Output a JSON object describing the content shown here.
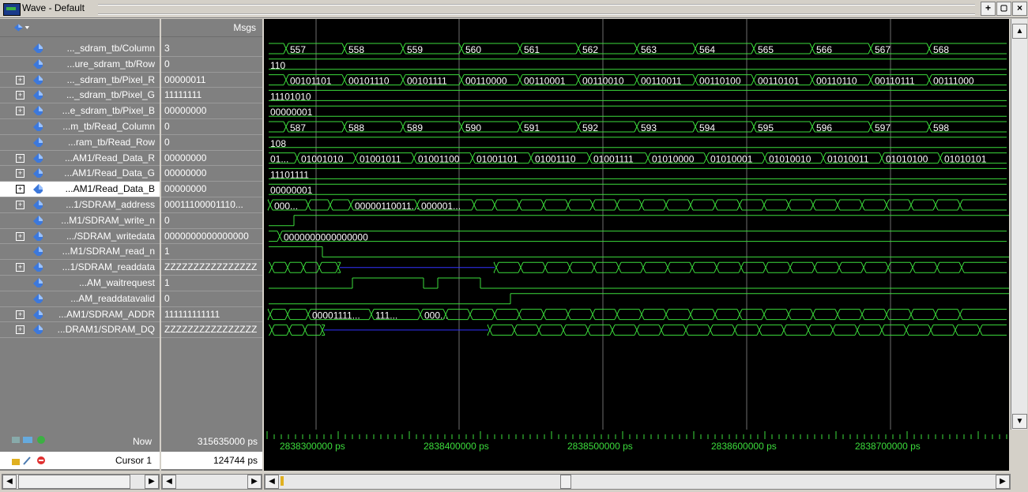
{
  "window": {
    "title": "Wave - Default"
  },
  "header": {
    "msgs_label": "Msgs"
  },
  "signals": [
    {
      "name": "..._sdram_tb/Column",
      "value": "3",
      "expandable": false
    },
    {
      "name": "...ure_sdram_tb/Row",
      "value": "0",
      "expandable": false
    },
    {
      "name": "..._sdram_tb/Pixel_R",
      "value": "00000011",
      "expandable": true
    },
    {
      "name": "..._sdram_tb/Pixel_G",
      "value": "11111111",
      "expandable": true
    },
    {
      "name": "...e_sdram_tb/Pixel_B",
      "value": "00000000",
      "expandable": true
    },
    {
      "name": "...m_tb/Read_Column",
      "value": "0",
      "expandable": false
    },
    {
      "name": "...ram_tb/Read_Row",
      "value": "0",
      "expandable": false
    },
    {
      "name": "...AM1/Read_Data_R",
      "value": "00000000",
      "expandable": true
    },
    {
      "name": "...AM1/Read_Data_G",
      "value": "00000000",
      "expandable": true
    },
    {
      "name": "...AM1/Read_Data_B",
      "value": "00000000",
      "expandable": true,
      "selected": true
    },
    {
      "name": "...1/SDRAM_address",
      "value": "00011100001110...",
      "expandable": true
    },
    {
      "name": "...M1/SDRAM_write_n",
      "value": "0",
      "expandable": false
    },
    {
      "name": ".../SDRAM_writedata",
      "value": "0000000000000000",
      "expandable": true
    },
    {
      "name": "...M1/SDRAM_read_n",
      "value": "1",
      "expandable": false
    },
    {
      "name": "...1/SDRAM_readdata",
      "value": "ZZZZZZZZZZZZZZZZ",
      "expandable": true
    },
    {
      "name": "...AM_waitrequest",
      "value": "1",
      "expandable": false
    },
    {
      "name": "...AM_readdatavalid",
      "value": "0",
      "expandable": false
    },
    {
      "name": "...AM1/SDRAM_ADDR",
      "value": "111111111111",
      "expandable": true
    },
    {
      "name": "...DRAM1/SDRAM_DQ",
      "value": "ZZZZZZZZZZZZZZZZ",
      "expandable": true
    }
  ],
  "wave_labels": {
    "column": [
      "557",
      "558",
      "559",
      "560",
      "561",
      "562",
      "563",
      "564",
      "565",
      "566",
      "567",
      "568"
    ],
    "row": "110",
    "pixel_r": [
      "00101101",
      "00101110",
      "00101111",
      "00110000",
      "00110001",
      "00110010",
      "00110011",
      "00110100",
      "00110101",
      "00110110",
      "00110111",
      "00111000"
    ],
    "pixel_g": "11101010",
    "pixel_b": "00000001",
    "read_column": [
      "587",
      "588",
      "589",
      "590",
      "591",
      "592",
      "593",
      "594",
      "595",
      "596",
      "597",
      "598"
    ],
    "read_row": "108",
    "read_data_r": [
      "01...",
      "01001010",
      "01001011",
      "01001100",
      "01001101",
      "01001110",
      "01001111",
      "01010000",
      "01010001",
      "01010010",
      "01010011",
      "01010100",
      "01010101"
    ],
    "read_data_g": "11101111",
    "read_data_b": "00000001",
    "sdram_address": [
      "000...",
      "00000110011...",
      "000001..."
    ],
    "sdram_writedata": "0000000000000000",
    "sdram_addr_labels": [
      "00001111...",
      "111...",
      "000..."
    ]
  },
  "status": {
    "now_label": "Now",
    "now_value": "315635000 ps",
    "cursor_label": "Cursor 1",
    "cursor_value": "124744 ps",
    "time_ticks": [
      "2838300000 ps",
      "2838400000 ps",
      "2838500000 ps",
      "2838600000 ps",
      "2838700000 ps"
    ]
  },
  "colors": {
    "wave": "#3cdc3c",
    "highz": "#3232ff",
    "background": "#000000",
    "panel": "#808080"
  }
}
